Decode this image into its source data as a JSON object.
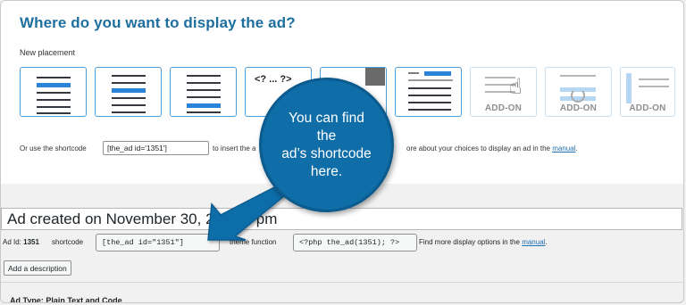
{
  "page": {
    "heading": "Where do you want to display the ad?",
    "subhead": "New placement"
  },
  "tiles": {
    "php_label": "<? ... ?>",
    "addon_label": "ADD-ON"
  },
  "shortcode_row": {
    "prefix": "Or use the shortcode",
    "value": "[the_ad id='1351']",
    "middle": "to insert the a",
    "suffix": "ore about your choices to display an ad in the",
    "link": "manual",
    "end": "."
  },
  "ad": {
    "title": "Ad created on November 30, 2021 6 pm",
    "id_label": "Ad Id:",
    "id_value": "1351",
    "shortcode_label": "shortcode",
    "shortcode_value": "[the_ad id=\"1351\"]",
    "theme_label": "theme function",
    "theme_value": "<?php the_ad(1351); ?>",
    "more_text": "Find more display options in the",
    "more_link": "manual",
    "more_end": ".",
    "description_button": "Add a description",
    "type_label": "Ad Type: Plain Text and Code"
  },
  "callout": {
    "line1": "You can find the",
    "line2": "ad’s shortcode",
    "line3": "here."
  },
  "colors": {
    "accent": "#1f6f9e",
    "callout_bg": "#0f6da8",
    "tile_border": "#4aa0d6",
    "link": "#2271b1"
  }
}
